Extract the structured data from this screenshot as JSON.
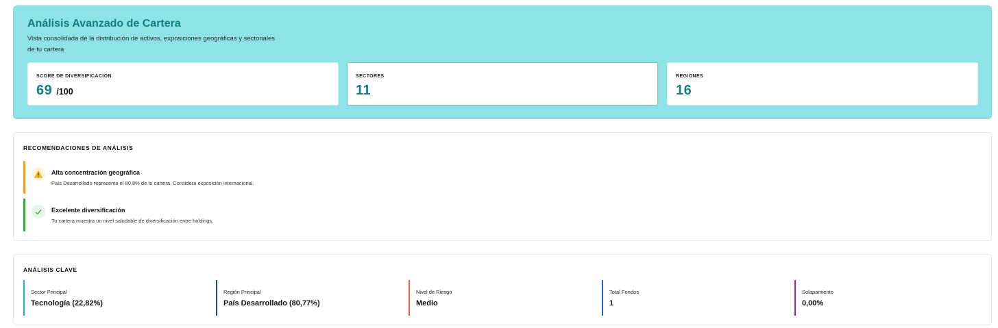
{
  "hero": {
    "title": "Análisis Avanzado de Cartera",
    "description": "Vista consolidada de la distribución de activos, exposiciones geográficas y sectoriales de tu cartera",
    "stats": [
      {
        "label": "SCORE DE DIVERSIFICACIÓN",
        "value": "69",
        "suffix": "/100"
      },
      {
        "label": "SECTORES",
        "value": "11",
        "suffix": ""
      },
      {
        "label": "REGIONES",
        "value": "16",
        "suffix": ""
      }
    ]
  },
  "recommendations": {
    "title": "RECOMENDACIONES DE ANÁLISIS",
    "items": [
      {
        "title": "Alta concentración geográfica",
        "text": "País Desarrollado representa el 80.8% de tu cartera. Considera exposición internacional.",
        "icon": "warning-icon",
        "color": "#f0a030"
      },
      {
        "title": "Excelente diversificación",
        "text": "Tu cartera muestra un nivel saludable de diversificación entre holdings.",
        "icon": "check-icon",
        "color": "#3aa845"
      }
    ]
  },
  "key_analysis": {
    "title": "ANÁLISIS CLAVE",
    "items": [
      {
        "label": "Sector Principal",
        "value": "Tecnología (22,82%)",
        "color": "#1fb5b5"
      },
      {
        "label": "Región Principal",
        "value": "País Desarrollado (80,77%)",
        "color": "#155a5c"
      },
      {
        "label": "Nivel de Riesgo",
        "value": "Medio",
        "color": "#f0643a"
      },
      {
        "label": "Total Fondos",
        "value": "1",
        "color": "#2060e0"
      },
      {
        "label": "Solapamiento",
        "value": "0,00%",
        "color": "#9a22b0"
      }
    ]
  },
  "colors": {
    "accent": "#137f82",
    "hero_bg": "#8ee3e6"
  }
}
